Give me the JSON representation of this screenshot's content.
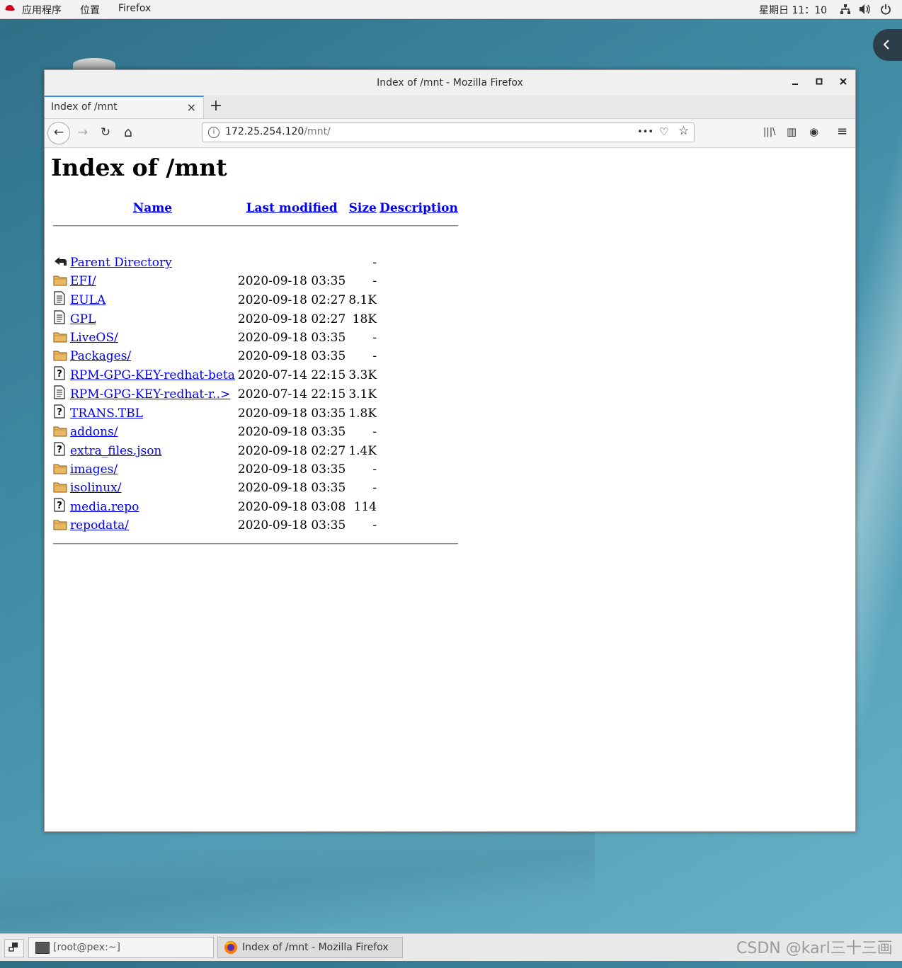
{
  "topbar": {
    "apps": "应用程序",
    "places": "位置",
    "app_name": "Firefox",
    "clock": "星期日 11：10"
  },
  "window": {
    "title": "Index of /mnt - Mozilla Firefox",
    "minimize": "–",
    "maximize": "□",
    "close": "×"
  },
  "tab": {
    "label": "Index of /mnt",
    "close": "×",
    "new_tab": "+"
  },
  "navbar": {
    "back": "←",
    "forward": "→",
    "reload": "↻",
    "home": "⌂",
    "url_host": "172.25.254.120",
    "url_path": "/mnt/",
    "page_actions": "•••",
    "pocket": "♡",
    "bookmark": "☆",
    "library": "|||\\",
    "sidebar": "▥",
    "account": "◉",
    "menu": "≡"
  },
  "page": {
    "heading": "Index of /mnt",
    "columns": {
      "name": "Name",
      "modified": "Last modified",
      "size": "Size",
      "description": "Description"
    },
    "rows": [
      {
        "icon": "back",
        "name": "Parent Directory",
        "modified": "",
        "size": "-"
      },
      {
        "icon": "folder",
        "name": "EFI/",
        "modified": "2020-09-18 03:35",
        "size": "-"
      },
      {
        "icon": "text",
        "name": "EULA",
        "modified": "2020-09-18 02:27",
        "size": "8.1K"
      },
      {
        "icon": "text",
        "name": "GPL",
        "modified": "2020-09-18 02:27",
        "size": "18K"
      },
      {
        "icon": "folder",
        "name": "LiveOS/",
        "modified": "2020-09-18 03:35",
        "size": "-"
      },
      {
        "icon": "folder",
        "name": "Packages/",
        "modified": "2020-09-18 03:35",
        "size": "-"
      },
      {
        "icon": "unknown",
        "name": "RPM-GPG-KEY-redhat-beta",
        "modified": "2020-07-14 22:15",
        "size": "3.3K"
      },
      {
        "icon": "text",
        "name": "RPM-GPG-KEY-redhat-r..>",
        "modified": "2020-07-14 22:15",
        "size": "3.1K"
      },
      {
        "icon": "unknown",
        "name": "TRANS.TBL",
        "modified": "2020-09-18 03:35",
        "size": "1.8K"
      },
      {
        "icon": "folder",
        "name": "addons/",
        "modified": "2020-09-18 03:35",
        "size": "-"
      },
      {
        "icon": "unknown",
        "name": "extra_files.json",
        "modified": "2020-09-18 02:27",
        "size": "1.4K"
      },
      {
        "icon": "folder",
        "name": "images/",
        "modified": "2020-09-18 03:35",
        "size": "-"
      },
      {
        "icon": "folder",
        "name": "isolinux/",
        "modified": "2020-09-18 03:35",
        "size": "-"
      },
      {
        "icon": "unknown",
        "name": "media.repo",
        "modified": "2020-09-18 03:08",
        "size": "114"
      },
      {
        "icon": "folder",
        "name": "repodata/",
        "modified": "2020-09-18 03:35",
        "size": "-"
      }
    ]
  },
  "taskbar": {
    "terminal": "[root@pex:~]",
    "firefox": "Index of /mnt - Mozilla Firefox"
  },
  "watermark": "CSDN @karl三十三画",
  "colors": {
    "link": "#0000ee",
    "folder": "#e8b862",
    "accent_tab": "#3b8bd8"
  }
}
